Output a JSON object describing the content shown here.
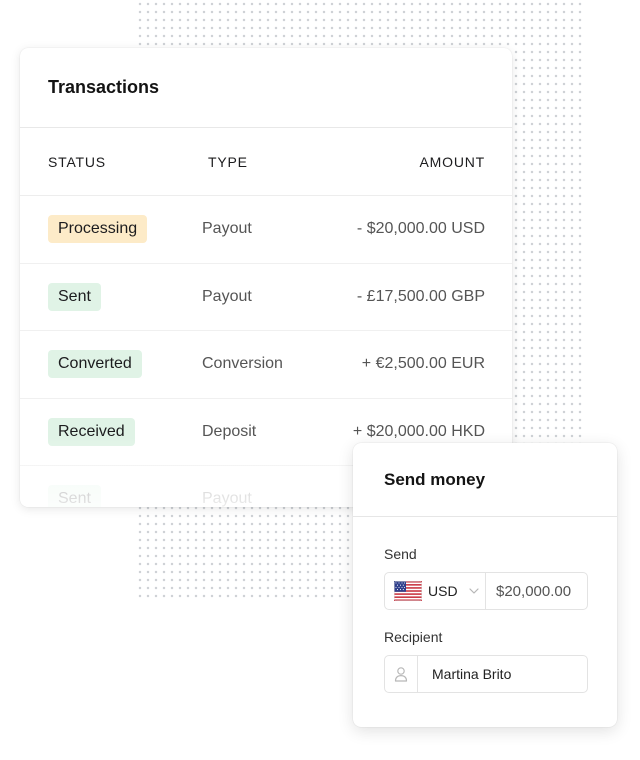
{
  "transactions": {
    "title": "Transactions",
    "columns": {
      "status": "STATUS",
      "type": "TYPE",
      "amount": "AMOUNT"
    },
    "rows": [
      {
        "status": "Processing",
        "status_kind": "processing",
        "type": "Payout",
        "amount": "- $20,000.00 USD"
      },
      {
        "status": "Sent",
        "status_kind": "green",
        "type": "Payout",
        "amount": "- £17,500.00 GBP"
      },
      {
        "status": "Converted",
        "status_kind": "green",
        "type": "Conversion",
        "amount": "+ €2,500.00 EUR"
      },
      {
        "status": "Received",
        "status_kind": "green",
        "type": "Deposit",
        "amount": "+ $20,000.00 HKD"
      },
      {
        "status": "Sent",
        "status_kind": "green",
        "type": "Payout",
        "amount": ""
      }
    ]
  },
  "send_money": {
    "title": "Send money",
    "send_label": "Send",
    "currency": "USD",
    "amount": "$20,000.00",
    "recipient_label": "Recipient",
    "recipient_name": "Martina Brito"
  },
  "icons": {
    "flag": "us-flag-icon",
    "chevron": "chevron-down-icon",
    "user": "user-icon"
  },
  "colors": {
    "processing_badge": "#fdebc8",
    "success_badge": "#e0f3e6"
  }
}
